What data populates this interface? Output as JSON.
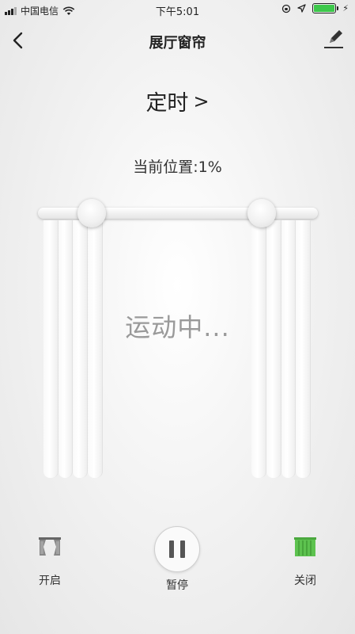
{
  "status_bar": {
    "carrier": "中国电信",
    "time": "下午5:01",
    "battery_color": "#3cc84a"
  },
  "nav": {
    "title": "展厅窗帘",
    "back_icon": "chevron-left-icon",
    "edit_icon": "pencil-icon"
  },
  "timer": {
    "label": "定时",
    "chevron": ">"
  },
  "position": {
    "text": "当前位置:1%",
    "value_percent": 1
  },
  "curtain": {
    "status": "运动中..."
  },
  "controls": {
    "open_label": "开启",
    "pause_label": "暂停",
    "close_label": "关闭",
    "close_icon_color": "#5dc24f"
  }
}
